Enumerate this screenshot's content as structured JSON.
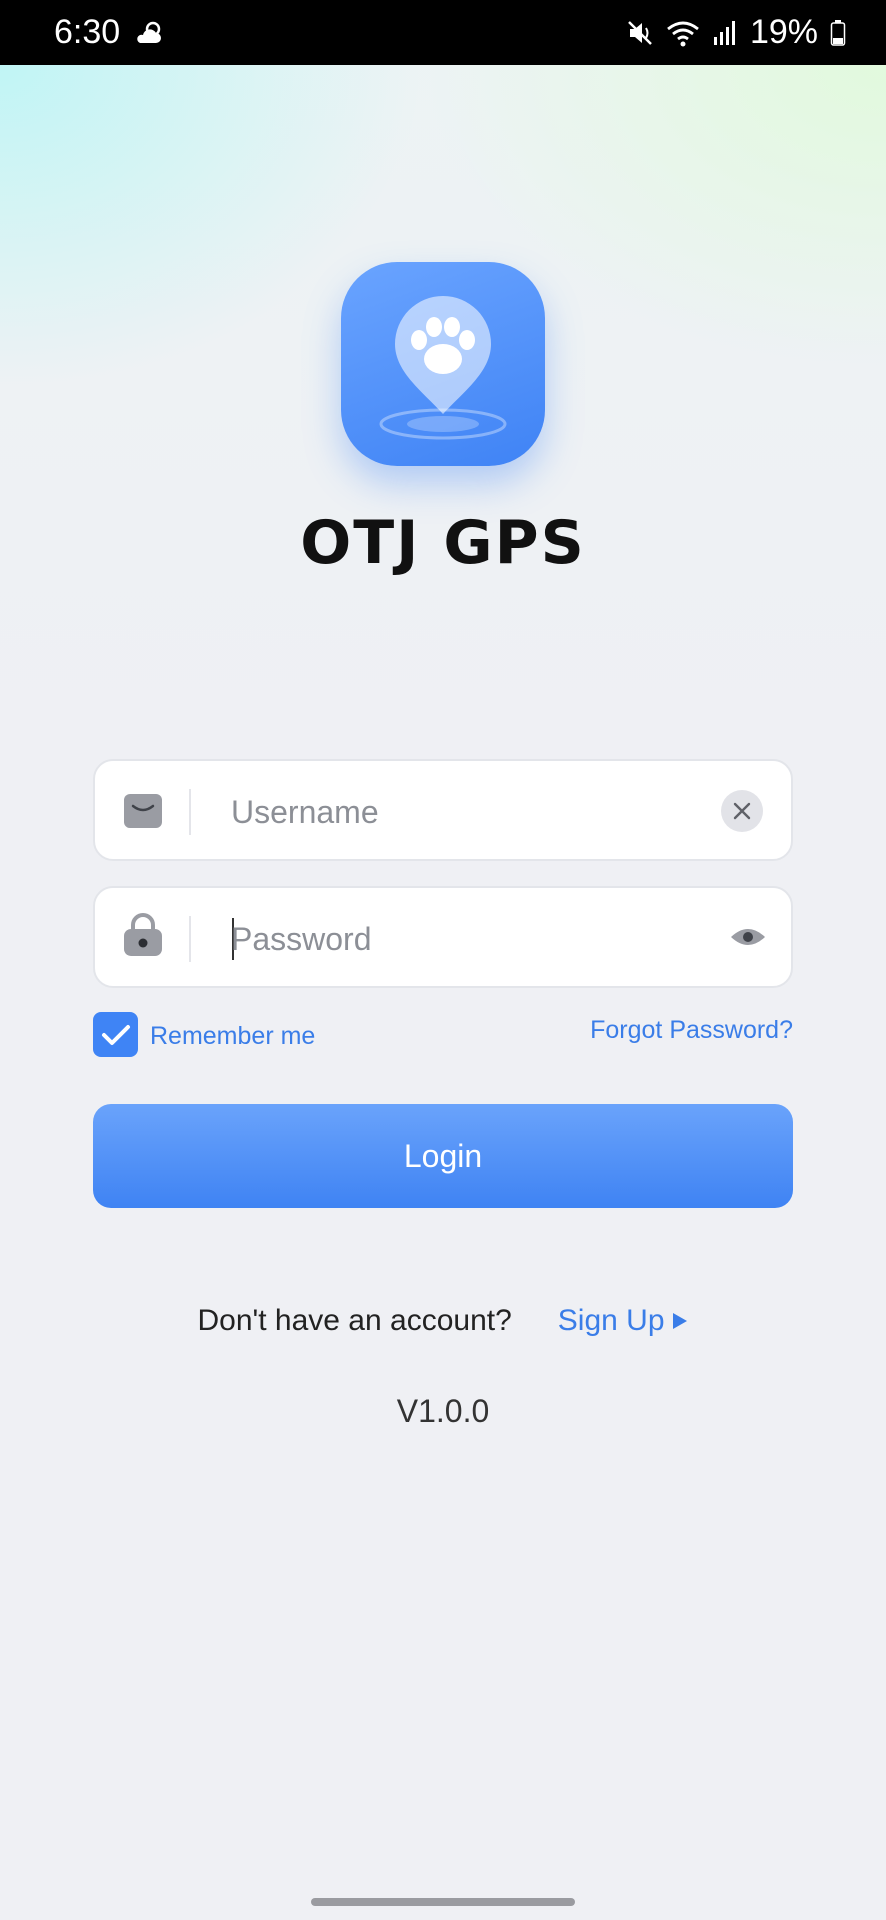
{
  "status_bar": {
    "time": "6:30",
    "weather_icon": "partly-cloudy-icon",
    "battery": "19%",
    "icons": [
      "mute-icon",
      "wifi-icon",
      "signal-icon",
      "battery-icon"
    ]
  },
  "app": {
    "title": "OTJ GPS",
    "logo_icon": "paw-location-pin-icon",
    "accent_color": "#3f84f5"
  },
  "login_form": {
    "username": {
      "placeholder": "Username",
      "value": "",
      "icon": "mail-icon",
      "action_icon": "clear-icon"
    },
    "password": {
      "placeholder": "Password",
      "value": "",
      "icon": "lock-icon",
      "action_icon": "eye-icon"
    },
    "remember_me": {
      "label": "Remember me",
      "checked": true
    },
    "forgot_password": "Forgot Password?",
    "login_label": "Login"
  },
  "footer": {
    "no_account_text": "Don't have an account?",
    "signup_label": "Sign Up",
    "version": "V1.0.0"
  }
}
